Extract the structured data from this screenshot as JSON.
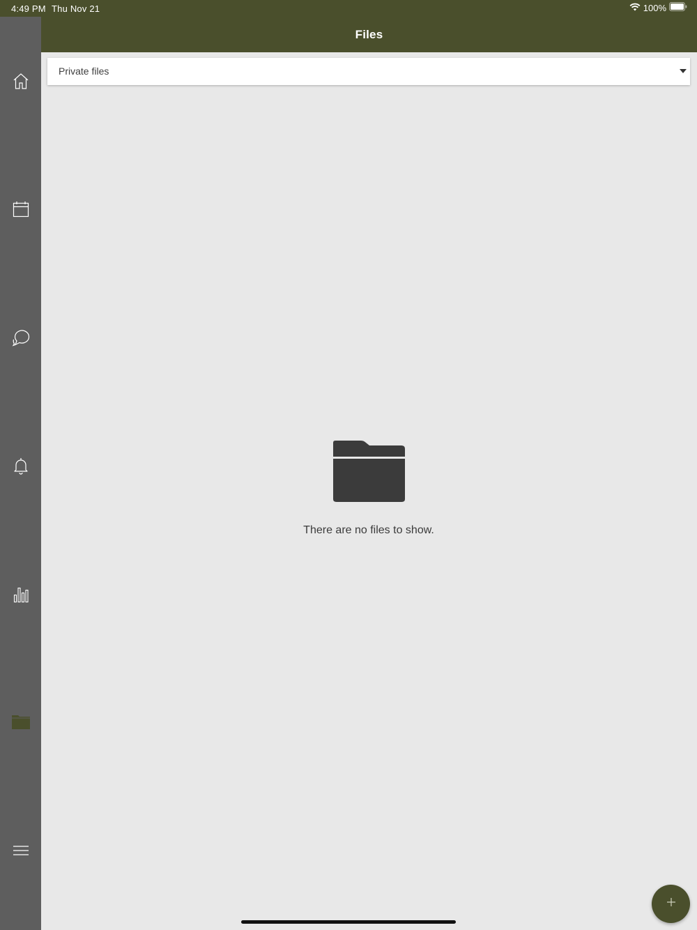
{
  "status_bar": {
    "time": "4:49 PM",
    "date": "Thu Nov 21",
    "battery_percent": "100%",
    "icons": [
      "wifi-icon",
      "battery-icon"
    ]
  },
  "header": {
    "title": "Files"
  },
  "sidebar": {
    "items": [
      {
        "icon": "home-icon",
        "active": false
      },
      {
        "icon": "calendar-icon",
        "active": false
      },
      {
        "icon": "chat-icon",
        "active": false
      },
      {
        "icon": "bell-icon",
        "active": false
      },
      {
        "icon": "bar-chart-icon",
        "active": false
      },
      {
        "icon": "folder-icon",
        "active": true
      },
      {
        "icon": "menu-icon",
        "active": false
      }
    ]
  },
  "filter": {
    "selected": "Private files"
  },
  "empty_state": {
    "icon": "folder-icon",
    "message": "There are no files to show."
  },
  "fab": {
    "icon": "plus-icon"
  },
  "colors": {
    "brand": "#4a4f2c",
    "sidebar": "#5e5e5e",
    "background": "#e8e8e8",
    "empty_icon": "#3b3b3b"
  }
}
